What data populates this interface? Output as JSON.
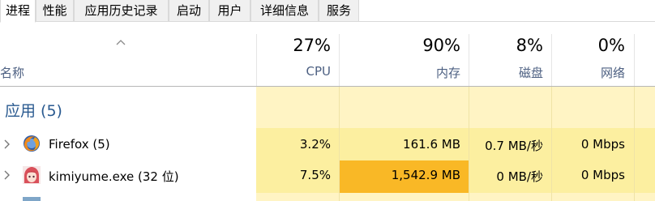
{
  "tabs": [
    {
      "label": "进程",
      "active": true
    },
    {
      "label": "性能",
      "active": false
    },
    {
      "label": "应用历史记录",
      "active": false
    },
    {
      "label": "启动",
      "active": false
    },
    {
      "label": "用户",
      "active": false
    },
    {
      "label": "详细信息",
      "active": false
    },
    {
      "label": "服务",
      "active": false
    }
  ],
  "columns": {
    "name": {
      "label": "名称"
    },
    "cpu": {
      "percent": "27%",
      "label": "CPU"
    },
    "memory": {
      "percent": "90%",
      "label": "内存"
    },
    "disk": {
      "percent": "8%",
      "label": "磁盘"
    },
    "network": {
      "percent": "0%",
      "label": "网络"
    }
  },
  "group": {
    "title": "应用 (5)"
  },
  "rows": [
    {
      "name": "Firefox (5)",
      "icon": "firefox-icon",
      "cpu": "3.2%",
      "memory": "161.6 MB",
      "disk": "0.7 MB/秒",
      "network": "0 Mbps"
    },
    {
      "name": "kimiyume.exe (32 位)",
      "icon": "anime-avatar-icon",
      "cpu": "7.5%",
      "memory": "1,542.9 MB",
      "disk": "0 MB/秒",
      "network": "0 Mbps"
    }
  ],
  "colors": {
    "header_label": "#4d6082",
    "group_title": "#2a5a90",
    "heat_light": "#fff4c4",
    "heat_row": "#fcefa0",
    "heat_hot": "#f9b826"
  }
}
